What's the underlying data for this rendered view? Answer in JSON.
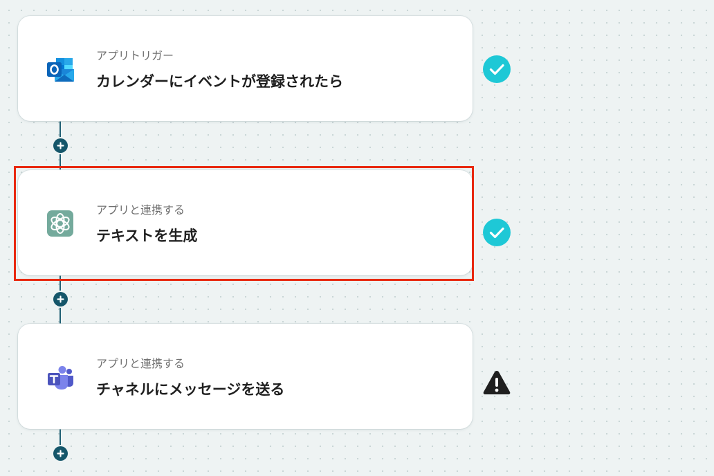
{
  "flow": {
    "steps": [
      {
        "app_icon": "outlook-icon",
        "category": "アプリトリガー",
        "title": "カレンダーにイベントが登録されたら",
        "status_icon": "check-circle-icon"
      },
      {
        "app_icon": "chatgpt-icon",
        "category": "アプリと連携する",
        "title": "テキストを生成",
        "status_icon": "check-circle-icon"
      },
      {
        "app_icon": "teams-icon",
        "category": "アプリと連携する",
        "title": "チャネルにメッセージを送る",
        "status_icon": "warning-icon"
      }
    ],
    "selected_step": 2
  },
  "colors": {
    "background": "#eef3f3",
    "connector": "#1f5f73",
    "add_button": "#15566a",
    "check_status": "#1ec8d6",
    "warning_status": "#1f1f1f",
    "selection_border": "#e8280f"
  }
}
